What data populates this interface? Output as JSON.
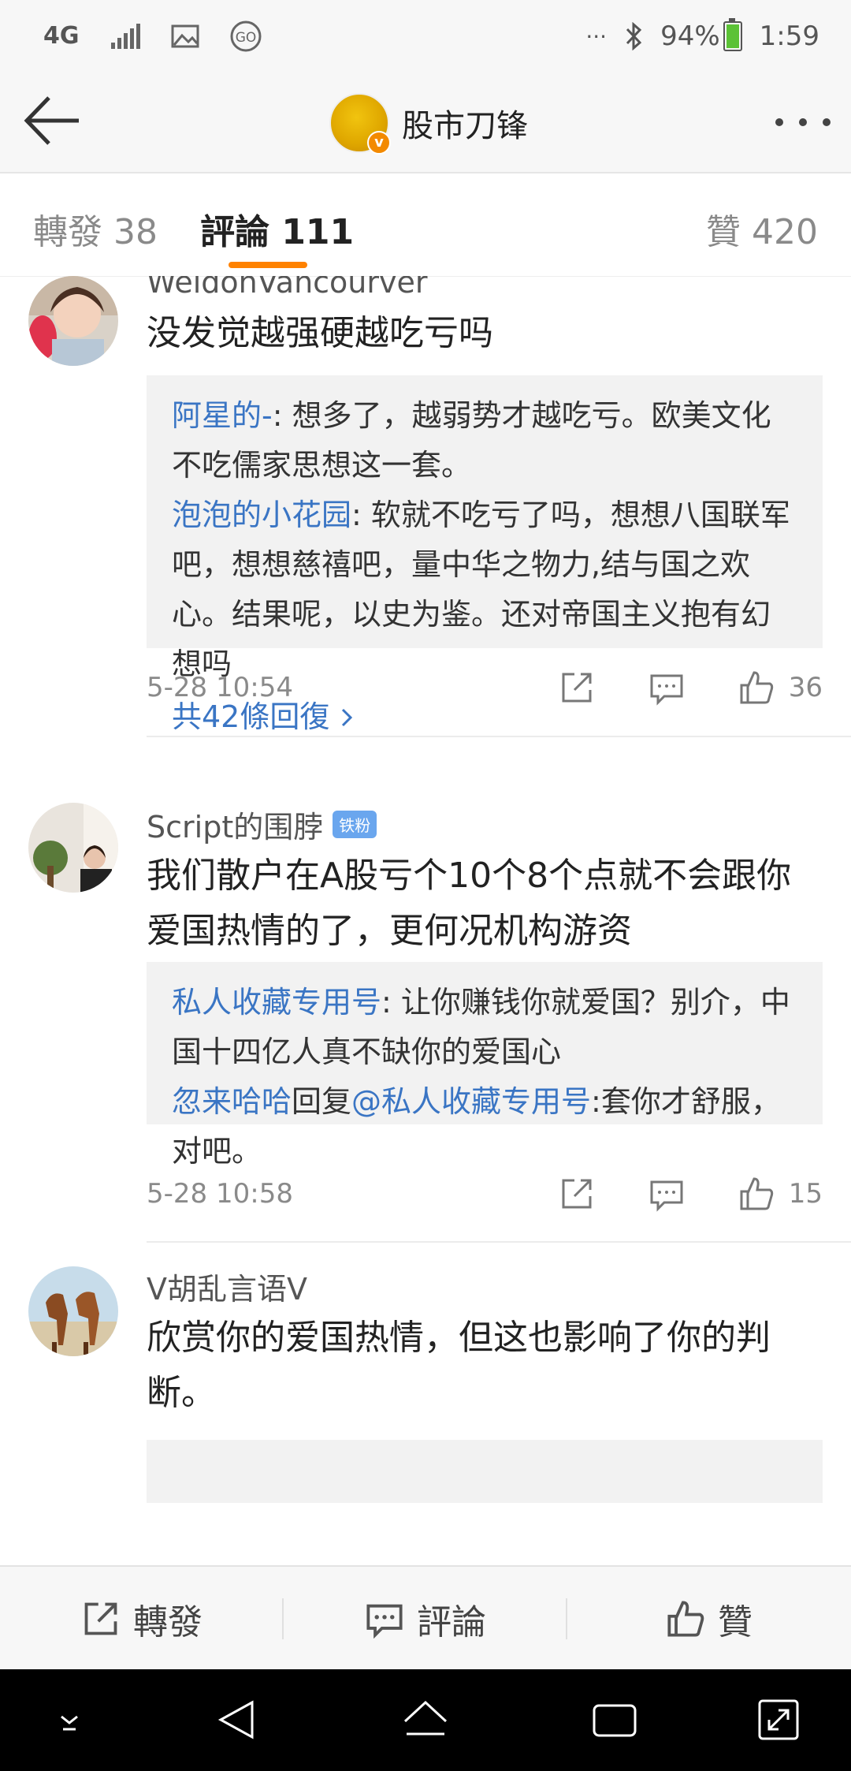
{
  "status_bar": {
    "network": "4G",
    "more": "···",
    "battery": "94%",
    "time": "1:59"
  },
  "header": {
    "title": "股市刀锋",
    "verified_mark": "v"
  },
  "tabs": [
    {
      "label": "轉發 38"
    },
    {
      "label": "評論 111",
      "active": true
    },
    {
      "label": "贊 420"
    }
  ],
  "comments": [
    {
      "user": "WeldonVancourver",
      "text": "没发觉越强硬越吃亏吗",
      "replies": [
        {
          "user": "阿星的-",
          "text": ": 想多了，越弱势才越吃亏。欧美文化不吃儒家思想这一套。"
        },
        {
          "user": "泡泡的小花园",
          "text": ": 软就不吃亏了吗，想想八国联军吧，想想慈禧吧，量中华之物力,结与国之欢心。结果呢，以史为鉴。还对帝国主义抱有幻想吗"
        }
      ],
      "more_replies": "共42條回復",
      "time": "5-28 10:54",
      "likes": "36"
    },
    {
      "user": "Script的围脖",
      "badge": "铁粉",
      "text": "我们散户在A股亏个10个8个点就不会跟你爱国热情的了，更何况机构游资",
      "replies": [
        {
          "user": "私人收藏专用号",
          "text": ": 让你赚钱你就爱国？别介，中国十四亿人真不缺你的爱国心"
        },
        {
          "user": "忽来哈哈",
          "mid": "回复",
          "mention": "@私人收藏专用号",
          "text": ":套你才舒服，对吧。"
        }
      ],
      "time": "5-28 10:58",
      "likes": "15"
    },
    {
      "user": "V胡乱言语V",
      "text": "欣赏你的爱国热情，但这也影响了你的判断。"
    }
  ],
  "action_bar": {
    "repost": "轉發",
    "comment": "評論",
    "like": "贊"
  },
  "colors": {
    "accent": "#ff8200",
    "link": "#3a75c4",
    "badge": "#6aa6ee"
  },
  "icons": [
    "back-arrow-icon",
    "more-dots-icon",
    "share-icon",
    "comment-icon",
    "like-icon",
    "nav-down-icon",
    "nav-back-icon",
    "nav-home-icon",
    "nav-recents-icon",
    "nav-expand-icon"
  ]
}
